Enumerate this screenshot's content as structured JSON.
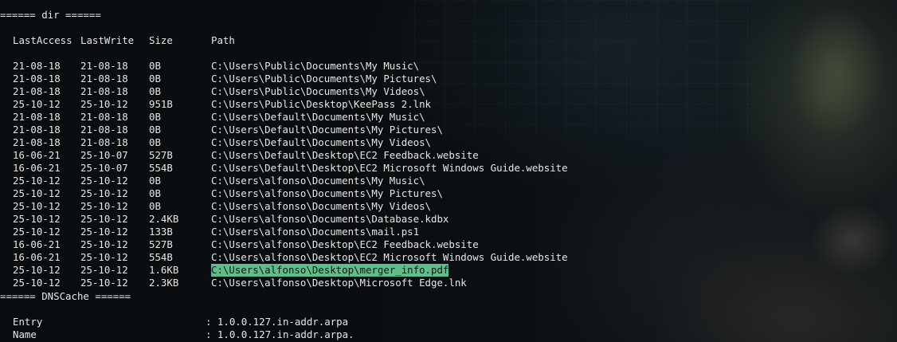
{
  "dir_section": {
    "header": "====== dir ======",
    "columns": {
      "last_access": "LastAccess",
      "last_write": "LastWrite",
      "size": "Size",
      "path": "Path"
    },
    "rows": [
      {
        "last_access": "21-08-18",
        "last_write": "21-08-18",
        "size": "0B",
        "path": "C:\\Users\\Public\\Documents\\My Music\\"
      },
      {
        "last_access": "21-08-18",
        "last_write": "21-08-18",
        "size": "0B",
        "path": "C:\\Users\\Public\\Documents\\My Pictures\\"
      },
      {
        "last_access": "21-08-18",
        "last_write": "21-08-18",
        "size": "0B",
        "path": "C:\\Users\\Public\\Documents\\My Videos\\"
      },
      {
        "last_access": "25-10-12",
        "last_write": "25-10-12",
        "size": "951B",
        "path": "C:\\Users\\Public\\Desktop\\KeePass 2.lnk"
      },
      {
        "last_access": "21-08-18",
        "last_write": "21-08-18",
        "size": "0B",
        "path": "C:\\Users\\Default\\Documents\\My Music\\"
      },
      {
        "last_access": "21-08-18",
        "last_write": "21-08-18",
        "size": "0B",
        "path": "C:\\Users\\Default\\Documents\\My Pictures\\"
      },
      {
        "last_access": "21-08-18",
        "last_write": "21-08-18",
        "size": "0B",
        "path": "C:\\Users\\Default\\Documents\\My Videos\\"
      },
      {
        "last_access": "16-06-21",
        "last_write": "25-10-07",
        "size": "527B",
        "path": "C:\\Users\\Default\\Desktop\\EC2 Feedback.website"
      },
      {
        "last_access": "16-06-21",
        "last_write": "25-10-07",
        "size": "554B",
        "path": "C:\\Users\\Default\\Desktop\\EC2 Microsoft Windows Guide.website"
      },
      {
        "last_access": "25-10-12",
        "last_write": "25-10-12",
        "size": "0B",
        "path": "C:\\Users\\alfonso\\Documents\\My Music\\"
      },
      {
        "last_access": "25-10-12",
        "last_write": "25-10-12",
        "size": "0B",
        "path": "C:\\Users\\alfonso\\Documents\\My Pictures\\"
      },
      {
        "last_access": "25-10-12",
        "last_write": "25-10-12",
        "size": "0B",
        "path": "C:\\Users\\alfonso\\Documents\\My Videos\\"
      },
      {
        "last_access": "25-10-12",
        "last_write": "25-10-12",
        "size": "2.4KB",
        "path": "C:\\Users\\alfonso\\Documents\\Database.kdbx"
      },
      {
        "last_access": "25-10-12",
        "last_write": "25-10-12",
        "size": "133B",
        "path": "C:\\Users\\alfonso\\Documents\\mail.ps1"
      },
      {
        "last_access": "16-06-21",
        "last_write": "25-10-12",
        "size": "527B",
        "path": "C:\\Users\\alfonso\\Desktop\\EC2 Feedback.website"
      },
      {
        "last_access": "16-06-21",
        "last_write": "25-10-12",
        "size": "554B",
        "path": "C:\\Users\\alfonso\\Desktop\\EC2 Microsoft Windows Guide.website"
      },
      {
        "last_access": "25-10-12",
        "last_write": "25-10-12",
        "size": "1.6KB",
        "path": "C:\\Users\\alfonso\\Desktop\\merger_info.pdf",
        "highlighted": true
      },
      {
        "last_access": "25-10-12",
        "last_write": "25-10-12",
        "size": "2.3KB",
        "path": "C:\\Users\\alfonso\\Desktop\\Microsoft Edge.lnk"
      }
    ]
  },
  "dnscache_section": {
    "header": "====== DNSCache ======",
    "entries": [
      {
        "key": "Entry",
        "sep": ": ",
        "value": "1.0.0.127.in-addr.arpa"
      },
      {
        "key": "Name",
        "sep": ": ",
        "value": "1.0.0.127.in-addr.arpa."
      }
    ]
  },
  "colors": {
    "background": "#090c0e",
    "text": "#e6e6e6",
    "highlight_background": "#5fbd8a",
    "highlight_text": "#0c1a12"
  }
}
